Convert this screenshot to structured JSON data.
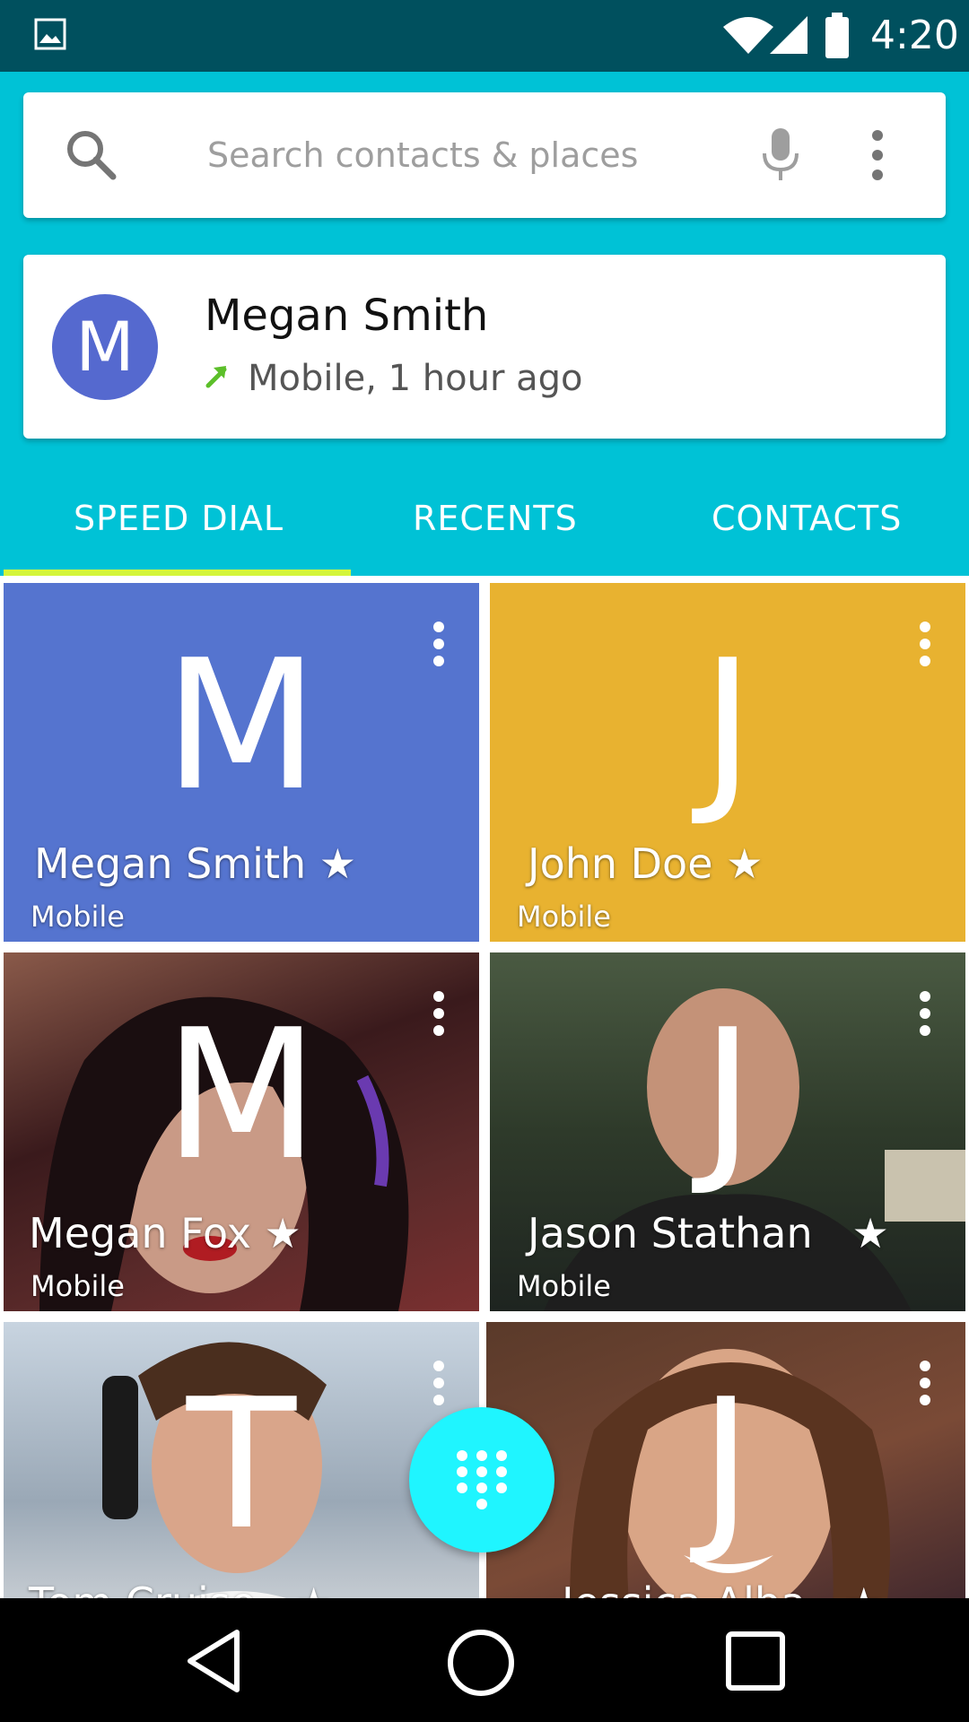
{
  "status_bar": {
    "time": "4:20",
    "icons": [
      "image-icon",
      "wifi-icon",
      "signal-icon",
      "battery-icon"
    ]
  },
  "search": {
    "placeholder": "Search contacts & places",
    "icons": [
      "search-icon",
      "mic-icon",
      "more-vert-icon"
    ]
  },
  "recent_call": {
    "avatar_letter": "M",
    "name": "Megan Smith",
    "detail": "Mobile, 1 hour ago",
    "avatar_color": "#5569cf",
    "arrow_color": "#5cbf2a"
  },
  "tabs": [
    {
      "label": "SPEED DIAL",
      "active": true
    },
    {
      "label": "RECENTS",
      "active": false
    },
    {
      "label": "CONTACTS",
      "active": false
    }
  ],
  "speed_dial": [
    {
      "letter": "M",
      "name": "Megan Smith ★",
      "label": "Mobile",
      "bg": "#5574cf",
      "photo": false
    },
    {
      "letter": "J",
      "name": "John Doe ★",
      "label": "Mobile",
      "bg": "#e8b230",
      "photo": false
    },
    {
      "letter": "M",
      "name": "Megan Fox ★",
      "label": "Mobile",
      "bg": "#4a2a2a",
      "photo": true
    },
    {
      "letter": "J",
      "name": "Jason Stathan   ★",
      "label": "Mobile",
      "bg": "#3f4a3a",
      "photo": true
    },
    {
      "letter": "T",
      "name": "Tom Cruise   ★",
      "label": "",
      "bg": "#7a8ea0",
      "photo": true
    },
    {
      "letter": "J",
      "name": "Jessica Alba   ★",
      "label": "",
      "bg": "#6a4232",
      "photo": true
    }
  ],
  "colors": {
    "primary": "#00c2d6",
    "status_bar": "#00505e",
    "tab_indicator": "#d4f53a",
    "fab": "#1ff5ff"
  }
}
